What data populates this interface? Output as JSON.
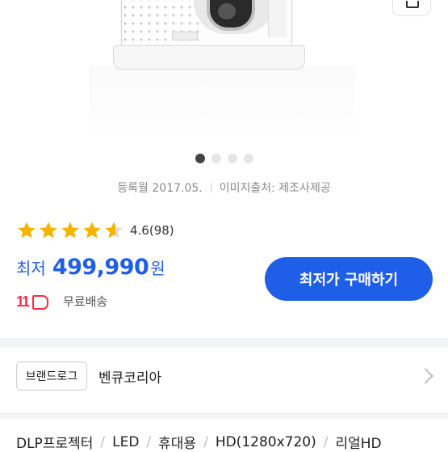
{
  "product": {
    "image": {
      "alt_icon": "projector-image"
    },
    "carousel": {
      "total": 4,
      "active": 1
    },
    "meta": {
      "registered": "등록월 2017.05.",
      "image_source": "이미지출처: 제조사제공"
    },
    "rating": {
      "score": "4.6",
      "count": "(98)",
      "stars_filled": 4.6,
      "stars_total": 5,
      "star_color": "#f5b400"
    },
    "price": {
      "prefix": "최저",
      "value": "499,990",
      "unit": "원",
      "accent_color": "#1f5fe8"
    },
    "shop": {
      "logo_text": "11",
      "shipping": "무료배송",
      "logo_color": "#ff2b43"
    },
    "buy_button": {
      "label": "최저가 구매하기"
    },
    "brand": {
      "chip_label": "브랜드로그",
      "name": "벤큐코리아"
    },
    "specs": [
      "DLP프로젝터",
      "LED",
      "휴대용",
      "HD(1280x720)",
      "리얼HD"
    ]
  }
}
